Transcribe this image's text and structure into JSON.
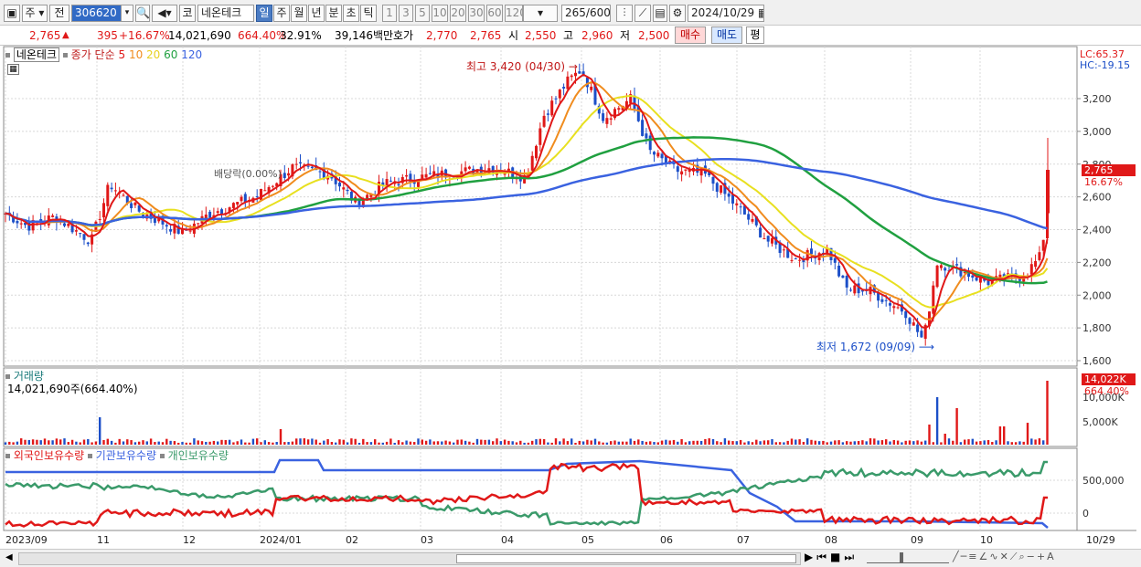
{
  "toolbar": {
    "market": "주",
    "prev_label": "전",
    "code": "306620",
    "type_label": "코",
    "name": "네온테크",
    "periods": [
      "일",
      "주",
      "월",
      "년",
      "분",
      "초",
      "틱"
    ],
    "intervals": [
      "1",
      "3",
      "5",
      "10",
      "20",
      "30",
      "60",
      "120"
    ],
    "count": "265",
    "count_total": "/600",
    "date": "2024/10/29"
  },
  "quote": {
    "price": "2,765",
    "change": "395",
    "change_pct": "+16.67%",
    "volume": "14,021,690",
    "volume_ratio": "664.40%",
    "turnover": "32.91%",
    "amount": "39,146백만",
    "bid_label": "호가",
    "bid1": "2,770",
    "bid2": "2,765",
    "open_label": "시",
    "open": "2,550",
    "high_label": "고",
    "high": "2,960",
    "low_label": "저",
    "low": "2,500",
    "buy_label": "매수",
    "sell_label": "매도",
    "eval_label": "평"
  },
  "price_pane": {
    "stock_label": "네온테크",
    "ma_label": "종가 단순",
    "ma_periods": [
      {
        "label": "5",
        "color": "#e01818"
      },
      {
        "label": "10",
        "color": "#f08c1e"
      },
      {
        "label": "20",
        "color": "#e8e020"
      },
      {
        "label": "60",
        "color": "#20a040"
      },
      {
        "label": "120",
        "color": "#3a62e0"
      }
    ],
    "lc": "LC:65.37",
    "hc": "HC:-19.15",
    "high_marker": "최고 3,420 (04/30)",
    "low_marker": "최저 1,672 (09/09)",
    "dividend_marker": "배당락(0.00%)",
    "current_price": "2,765",
    "current_pct": "16.67%",
    "y_ticks": [
      "3,200",
      "3,000",
      "2,800",
      "2,600",
      "2,400",
      "2,200",
      "2,000",
      "1,800",
      "1,600"
    ]
  },
  "volume_pane": {
    "title": "거래량",
    "value": "14,021,690주(664.40%)",
    "current": "14,022K",
    "current_pct": "664.40%",
    "y_ticks": [
      "10,000K",
      "5,000K"
    ]
  },
  "holding_pane": {
    "series": [
      {
        "name": "외국인보유수량",
        "color": "#e01818"
      },
      {
        "name": "기관보유수량",
        "color": "#3a62e0"
      },
      {
        "name": "개인보유수량",
        "color": "#3a9a6a"
      }
    ],
    "y_ticks": [
      "500,000",
      "0"
    ]
  },
  "x_labels": [
    "2023/09",
    "11",
    "12",
    "2024/01",
    "02",
    "03",
    "04",
    "05",
    "06",
    "07",
    "08",
    "09",
    "10",
    "10/29"
  ],
  "colors": {
    "up": "#e01818",
    "down": "#1c4fc8",
    "accent": "#4b7cc4"
  }
}
